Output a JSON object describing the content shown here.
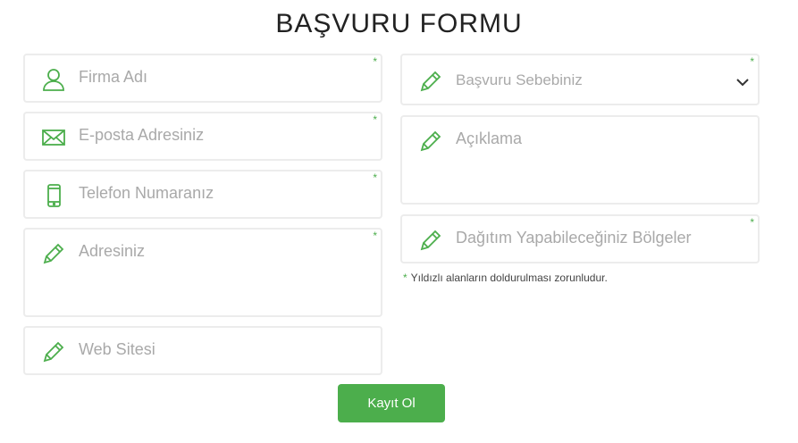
{
  "form": {
    "title": "BAŞVURU FORMU",
    "required_mark": "*",
    "left_fields": [
      {
        "placeholder": "Firma Adı",
        "icon": "user-icon",
        "required": true
      },
      {
        "placeholder": "E-posta Adresiniz",
        "icon": "envelope-icon",
        "required": true
      },
      {
        "placeholder": "Telefon Numaranız",
        "icon": "phone-icon",
        "required": true
      },
      {
        "placeholder": "Adresiniz",
        "icon": "pencil-icon",
        "required": true
      },
      {
        "placeholder": "Web Sitesi",
        "icon": "pencil-icon",
        "required": false
      }
    ],
    "right_fields": [
      {
        "placeholder": "Başvuru Sebebiniz",
        "icon": "pencil-icon",
        "required": true,
        "type": "select"
      },
      {
        "placeholder": "Açıklama",
        "icon": "pencil-icon",
        "required": false
      },
      {
        "placeholder": "Dağıtım Yapabileceğiniz Bölgeler",
        "icon": "pencil-icon",
        "required": true
      }
    ],
    "note": "Yıldızlı alanların doldurulması zorunludur.",
    "submit_label": "Kayıt Ol"
  },
  "colors": {
    "accent": "#4cae4c",
    "border": "#ececec",
    "placeholder": "#a9a9a9"
  }
}
